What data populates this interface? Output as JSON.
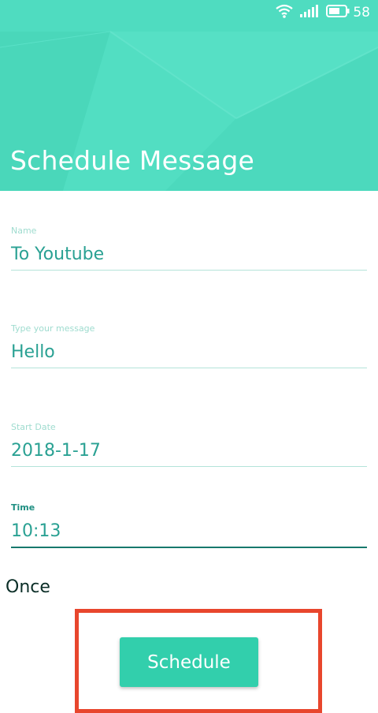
{
  "status_bar": {
    "battery_level": "58",
    "icons": [
      "wifi-icon",
      "signal-icon",
      "battery-icon"
    ]
  },
  "header": {
    "title": "Schedule Message",
    "background_color": "#4fdcc0"
  },
  "form": {
    "name": {
      "label": "Name",
      "value": "To Youtube"
    },
    "message": {
      "label": "Type your message",
      "value": "Hello"
    },
    "start_date": {
      "label": "Start Date",
      "value": "2018-1-17"
    },
    "time": {
      "label": "Time",
      "value": "10:13"
    }
  },
  "repeat": {
    "value": "Once"
  },
  "actions": {
    "schedule_label": "Schedule",
    "button_color": "#32cfac",
    "highlight_color": "#e8462d"
  }
}
